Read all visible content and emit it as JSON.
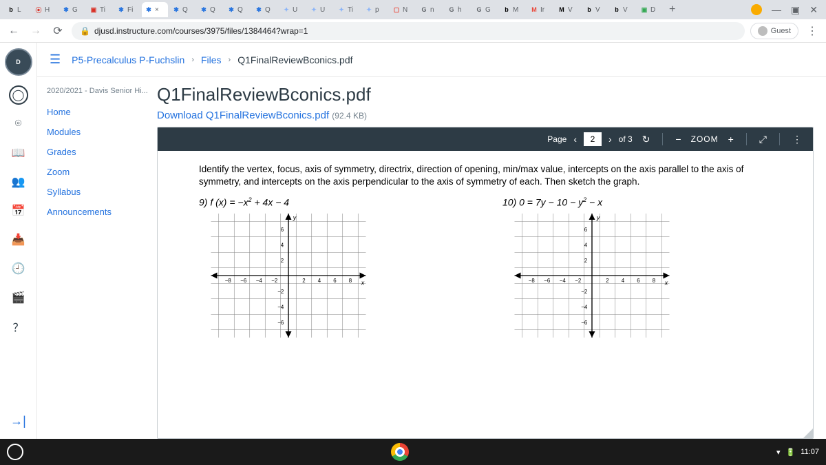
{
  "browser": {
    "tabs": [
      {
        "icon": "b",
        "label": "L",
        "color": "#000"
      },
      {
        "icon": "⦿",
        "label": "H",
        "color": "#d93025"
      },
      {
        "icon": "✱",
        "label": "G",
        "color": "#2573df"
      },
      {
        "icon": "▣",
        "label": "Ti",
        "color": "#d93025"
      },
      {
        "icon": "✱",
        "label": "Fi",
        "color": "#2573df"
      },
      {
        "icon": "✱",
        "label": "×",
        "color": "#2573df",
        "active": true
      },
      {
        "icon": "✱",
        "label": "Q",
        "color": "#2573df"
      },
      {
        "icon": "✱",
        "label": "Q",
        "color": "#2573df"
      },
      {
        "icon": "✱",
        "label": "Q",
        "color": "#2573df"
      },
      {
        "icon": "✱",
        "label": "Q",
        "color": "#2573df"
      },
      {
        "icon": "✦",
        "label": "U",
        "color": "#8ab4f8"
      },
      {
        "icon": "✦",
        "label": "U",
        "color": "#8ab4f8"
      },
      {
        "icon": "✦",
        "label": "Ti",
        "color": "#8ab4f8"
      },
      {
        "icon": "✦",
        "label": "p",
        "color": "#8ab4f8"
      },
      {
        "icon": "▢",
        "label": "N",
        "color": "#ea4335"
      },
      {
        "icon": "G",
        "label": "n",
        "color": "#5f6368"
      },
      {
        "icon": "G",
        "label": "h",
        "color": "#5f6368"
      },
      {
        "icon": "G",
        "label": "G",
        "color": "#5f6368"
      },
      {
        "icon": "b",
        "label": "M",
        "color": "#000"
      },
      {
        "icon": "M",
        "label": "Ir",
        "color": "#ea4335"
      },
      {
        "icon": "M",
        "label": "V",
        "color": "#000"
      },
      {
        "icon": "b",
        "label": "V",
        "color": "#000"
      },
      {
        "icon": "b",
        "label": "V",
        "color": "#000"
      },
      {
        "icon": "▣",
        "label": "D",
        "color": "#34a853"
      }
    ],
    "url": "djusd.instructure.com/courses/3975/files/1384464?wrap=1",
    "guest_label": "Guest"
  },
  "breadcrumbs": {
    "course": "P5-Precalculus P-Fuchslin",
    "files": "Files",
    "current": "Q1FinalReviewBconics.pdf"
  },
  "course_nav": {
    "term": "2020/2021 - Davis Senior Hi...",
    "items": [
      "Home",
      "Modules",
      "Grades",
      "Zoom",
      "Syllabus",
      "Announcements"
    ]
  },
  "file": {
    "title": "Q1FinalReviewBconics.pdf",
    "download_prefix": "Download Q1FinalReviewBconics.pdf",
    "size": "(92.4 KB)"
  },
  "viewer": {
    "page_label": "Page",
    "page_current": "2",
    "page_of": "of 3",
    "zoom_label": "ZOOM"
  },
  "pdf": {
    "instructions": "Identify the vertex, focus, axis of symmetry, directrix, direction of opening, min/max value, intercepts on the axis parallel to the axis of symmetry, and intercepts on the axis perpendicular to the axis of symmetry of each.  Then sketch the graph.",
    "prob9_label": "9)  f (x) = −x",
    "prob9_tail": " + 4x − 4",
    "prob10_label": "10)  0 = 7y − 10 − y",
    "prob10_tail": " − x",
    "axis_y": "y",
    "axis_x": "x"
  },
  "taskbar": {
    "time": "11:07"
  }
}
